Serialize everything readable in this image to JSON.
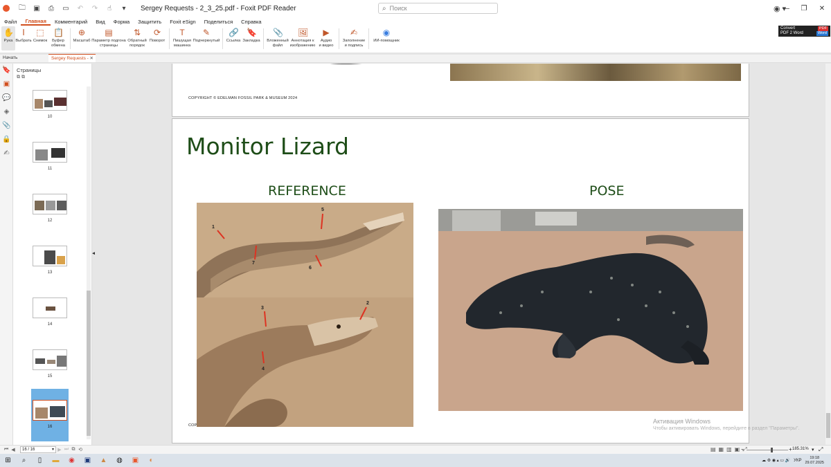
{
  "window": {
    "title": "Sergey Requests - 2_3_25.pdf - Foxit PDF Reader",
    "search_placeholder": "Поиск"
  },
  "menu": [
    "Файл",
    "Главная",
    "Комментарий",
    "Вид",
    "Форма",
    "Защитить",
    "Foxit eSign",
    "Поделиться",
    "Справка"
  ],
  "ribbon": [
    {
      "icon": "hand-icon",
      "label": "Рука",
      "glyph": "✋"
    },
    {
      "icon": "select-text-icon",
      "label": "Выбрать",
      "glyph": "Ⅰ"
    },
    {
      "icon": "snapshot-icon",
      "label": "Снимок",
      "glyph": "⬚"
    },
    {
      "icon": "clipboard-icon",
      "label": "Буфер\nобмена",
      "glyph": "📋"
    },
    {
      "icon": "zoom-icon",
      "label": "Масштаб",
      "glyph": "⊕"
    },
    {
      "icon": "page-fit-icon",
      "label": "Параметр подгона\nстраницы",
      "glyph": "▤"
    },
    {
      "icon": "reverse-order-icon",
      "label": "Обратный\nпорядок",
      "glyph": "⇅"
    },
    {
      "icon": "rotate-icon",
      "label": "Поворот",
      "glyph": "⟳"
    },
    {
      "icon": "typewriter-icon",
      "label": "Пишущая\nмашинка",
      "glyph": "T"
    },
    {
      "icon": "highlight-icon",
      "label": "Подчеркнутый",
      "glyph": "✎"
    },
    {
      "icon": "link-icon",
      "label": "Ссылка",
      "glyph": "🔗"
    },
    {
      "icon": "bookmark-icon",
      "label": "Закладка",
      "glyph": "🔖"
    },
    {
      "icon": "attachment-icon",
      "label": "Вложенный\nфайл",
      "glyph": "📎"
    },
    {
      "icon": "image-annotation-icon",
      "label": "Аннотация к\nизображению",
      "glyph": "🖼"
    },
    {
      "icon": "audio-video-icon",
      "label": "Аудио\nи видео",
      "glyph": "▶"
    },
    {
      "icon": "fill-sign-icon",
      "label": "Заполнение\nи подпись",
      "glyph": "✍"
    },
    {
      "icon": "ai-assistant-icon",
      "label": "ИИ-помощник",
      "glyph": "◉"
    }
  ],
  "convert_banner": {
    "line1": "Convert",
    "line2": "PDF 2 Word",
    "pdf": "PDF",
    "word": "Word"
  },
  "tabs": [
    {
      "label": "Начать"
    },
    {
      "label": "Sergey Requests - ..."
    }
  ],
  "panel": {
    "title": "Страницы",
    "thumbnails": [
      "10",
      "11",
      "12",
      "13",
      "14",
      "15",
      "16"
    ],
    "selected": "16"
  },
  "document": {
    "prev_page_copyright": "COPYRIGHT © EDELMAN FOSSIL PARK & MUSEUM 2024",
    "slide_title": "Monitor Lizard",
    "reference_title": "REFERENCE",
    "pose_title": "POSE",
    "bottom_copyright_fragment": "COP",
    "markers": [
      "1",
      "2",
      "3",
      "4",
      "5",
      "6",
      "7"
    ]
  },
  "os_watermark": {
    "line1": "Активация Windows",
    "line2": "Чтобы активировать Windows, перейдите в раздел \"Параметры\"."
  },
  "status": {
    "page_field": "16 / 16",
    "zoom": "185.31%"
  },
  "taskbar": {
    "lang": "УКР",
    "time": "19:18",
    "date": "29.07.2025"
  },
  "colors": {
    "accent": "#d14f1e",
    "title_green": "#1e4d18",
    "thumb_selected": "#6fb1e4"
  }
}
